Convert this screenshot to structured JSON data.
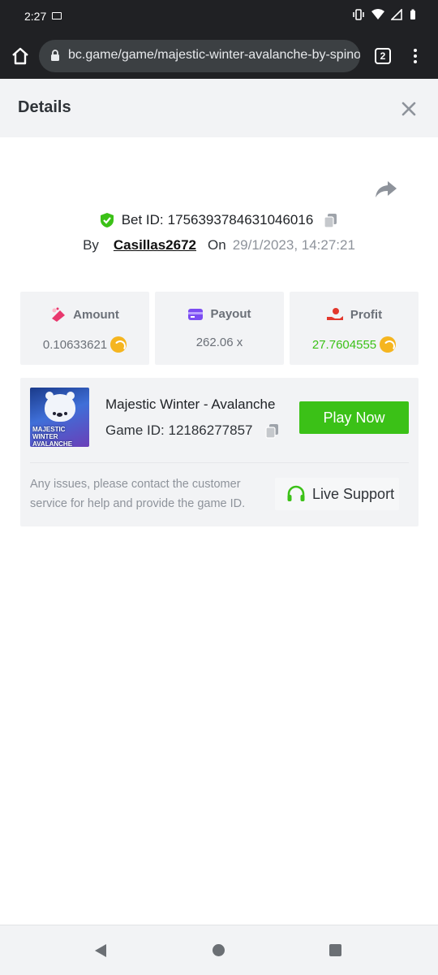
{
  "status_bar": {
    "time": "2:27"
  },
  "browser": {
    "url": "bc.game/game/majestic-winter-avalanche-by-spinom",
    "tab_count": "2"
  },
  "details": {
    "title": "Details",
    "bet_id_label": "Bet ID:",
    "bet_id": "1756393784631046016",
    "by_label": "By",
    "user": "Casillas2672",
    "on_label": "On",
    "date": "29/1/2023, 14:27:21"
  },
  "stats": {
    "amount": {
      "label": "Amount",
      "value": "0.10633621"
    },
    "payout": {
      "label": "Payout",
      "value": "262.06 x"
    },
    "profit": {
      "label": "Profit",
      "value": "27.7604555"
    }
  },
  "game": {
    "name": "Majestic Winter - Avalanche",
    "id_label": "Game ID:",
    "id": "12186277857",
    "thumb_title": "MAJESTIC WINTER AVALANCHE",
    "play_label": "Play Now",
    "notice": "Any issues, please contact the customer service for help and provide the game ID.",
    "support_label": "Live Support"
  },
  "colors": {
    "accent_green": "#3bc117",
    "coin": "#f5b51f",
    "amount_icon": "#e8386d",
    "payout_icon": "#7b4cf2",
    "profit_icon": "#e2382d"
  }
}
